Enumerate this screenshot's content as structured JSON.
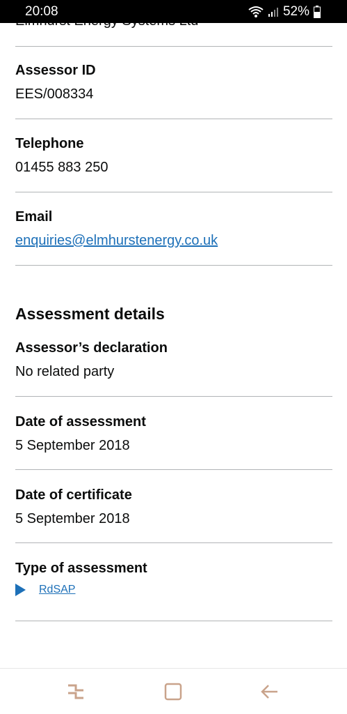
{
  "status_bar": {
    "time": "20:08",
    "battery": "52%"
  },
  "top_cut_text": "Elmhurst Energy Systems Ltd",
  "assessor": {
    "id_label": "Assessor ID",
    "id_value": "EES/008334",
    "telephone_label": "Telephone",
    "telephone_value": "01455 883 250",
    "email_label": "Email",
    "email_value": "enquiries@elmhurstenergy.co.uk"
  },
  "assessment": {
    "heading": "Assessment details",
    "declaration_label": "Assessor’s declaration",
    "declaration_value": "No related party",
    "date_assessment_label": "Date of assessment",
    "date_assessment_value": "5 September 2018",
    "date_certificate_label": "Date of certificate",
    "date_certificate_value": "5 September 2018",
    "type_label": "Type of assessment",
    "type_value": "RdSAP"
  },
  "nav_bar": {
    "recent_icon": "recent-apps-icon",
    "home_icon": "home-icon",
    "back_icon": "back-icon"
  },
  "colors": {
    "link": "#1d70b8",
    "divider": "#b1b4b6",
    "nav_icon": "#c9a38b"
  }
}
